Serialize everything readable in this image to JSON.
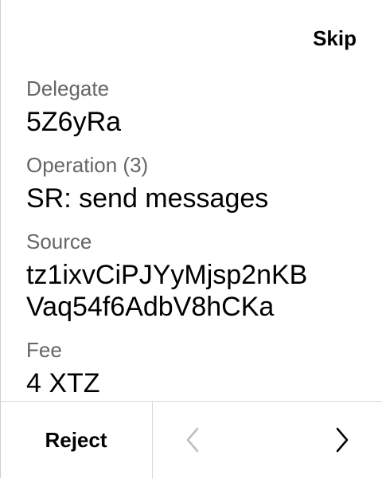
{
  "header": {
    "skip_label": "Skip"
  },
  "fields": [
    {
      "label": "Delegate",
      "value": "5Z6yRa"
    },
    {
      "label": "Operation (3)",
      "value": "SR: send messages"
    },
    {
      "label": "Source",
      "value_line1": "tz1ixvCiPJYyMjsp2nKB",
      "value_line2": "Vaq54f6AdbV8hCKa"
    },
    {
      "label": "Fee",
      "value": "4 XTZ"
    }
  ],
  "footer": {
    "reject_label": "Reject",
    "prev_icon": "chevron-left-icon",
    "next_icon": "chevron-right-icon",
    "prev_color": "#bdbdbd",
    "next_color": "#000000"
  }
}
